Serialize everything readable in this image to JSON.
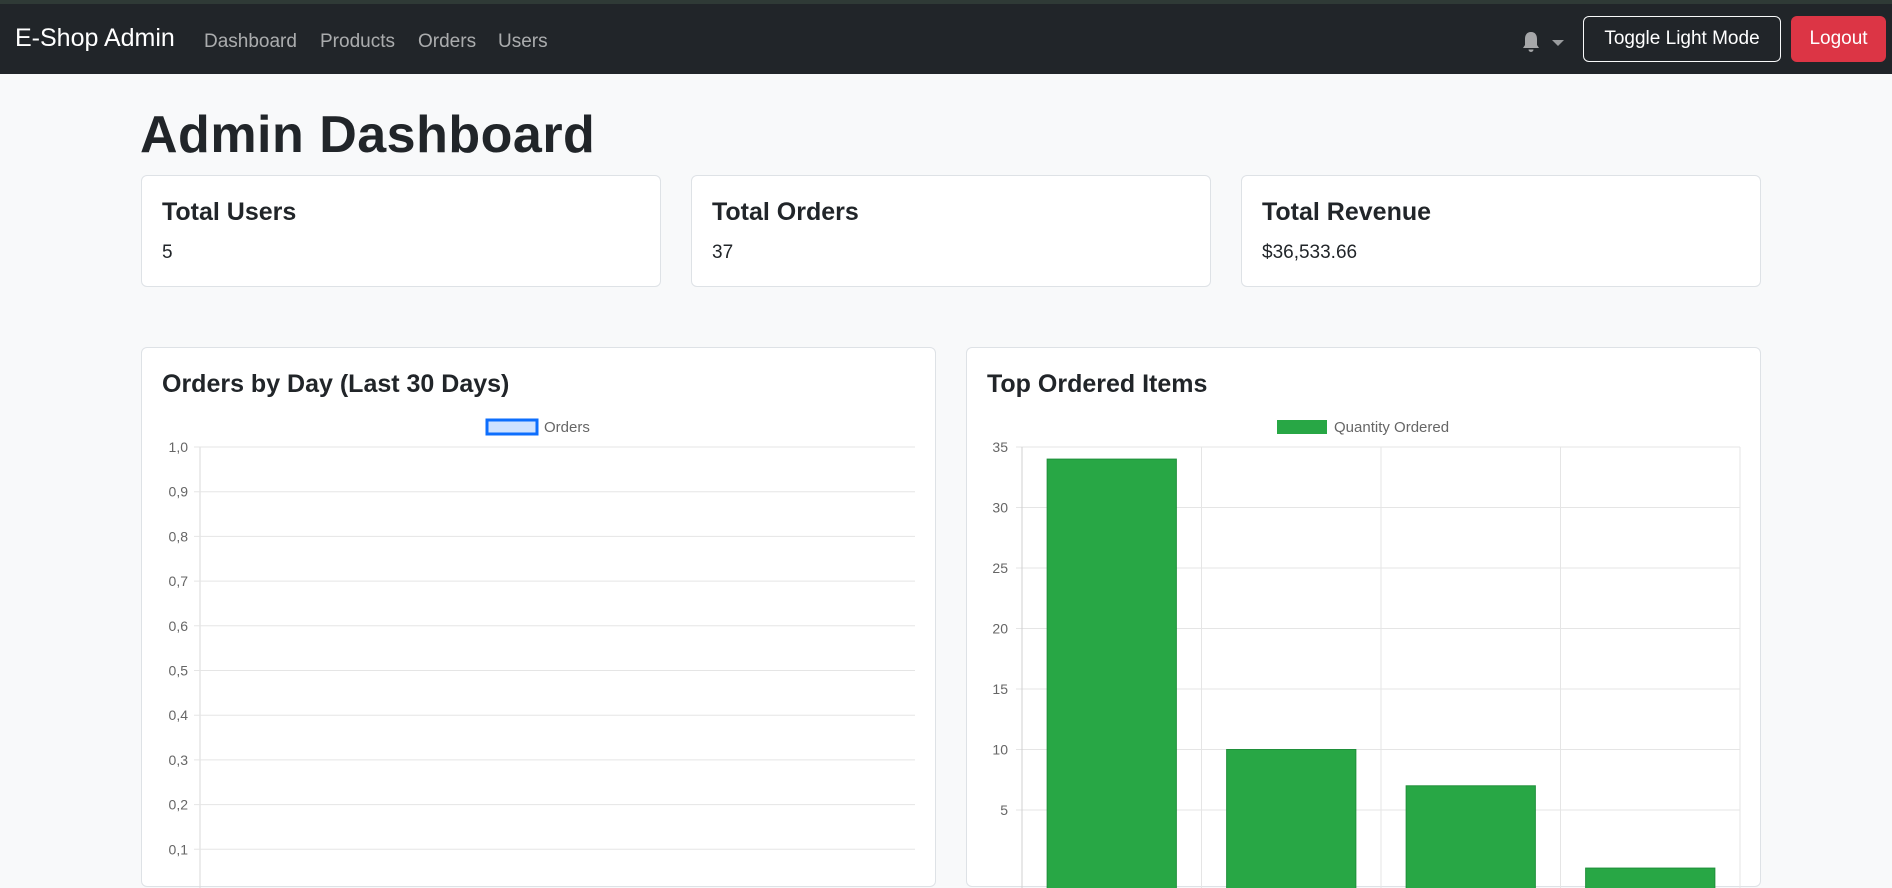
{
  "navbar": {
    "brand": "E-Shop Admin",
    "links": [
      "Dashboard",
      "Products",
      "Orders",
      "Users"
    ],
    "toggle_label": "Toggle Light Mode",
    "logout_label": "Logout",
    "notification_icon": "bell-icon"
  },
  "page": {
    "title": "Admin Dashboard"
  },
  "stats": [
    {
      "title": "Total Users",
      "value": "5"
    },
    {
      "title": "Total Orders",
      "value": "37"
    },
    {
      "title": "Total Revenue",
      "value": "$36,533.66"
    }
  ],
  "colors": {
    "navbar": "#212529",
    "logout": "#dc3545",
    "orders_line": "#0d6efd",
    "orders_fill": "#cfe2ff",
    "bar": "#28a745"
  },
  "charts": {
    "orders": {
      "title": "Orders by Day (Last 30 Days)"
    },
    "top_items": {
      "title": "Top Ordered Items"
    }
  },
  "chart_data": [
    {
      "type": "line",
      "title": "Orders by Day (Last 30 Days)",
      "series": [
        {
          "name": "Orders",
          "values": []
        }
      ],
      "yticks": [
        "1,0",
        "0,9",
        "0,8",
        "0,7",
        "0,6",
        "0,5",
        "0,4",
        "0,3",
        "0,2",
        "0,1"
      ],
      "ylim": [
        0,
        1
      ],
      "grid": true,
      "legend": "top-center"
    },
    {
      "type": "bar",
      "title": "Top Ordered Items",
      "series": [
        {
          "name": "Quantity Ordered",
          "values": [
            34,
            10,
            7,
            0.2
          ]
        }
      ],
      "yticks": [
        "35",
        "30",
        "25",
        "20",
        "15",
        "10",
        "5"
      ],
      "ylim": [
        0,
        35
      ],
      "grid": true,
      "legend": "top-center"
    }
  ]
}
